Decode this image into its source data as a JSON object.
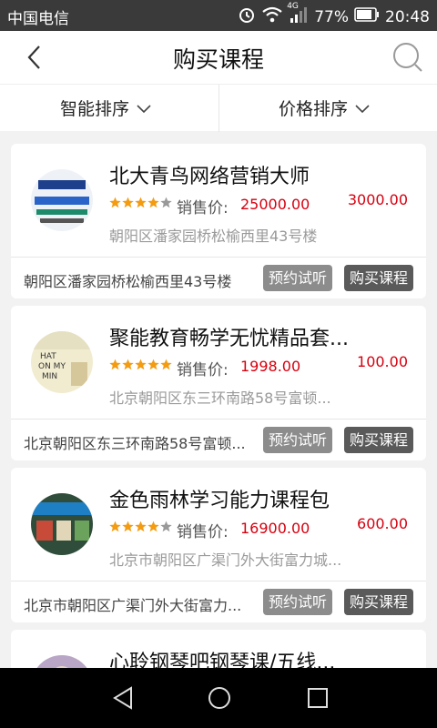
{
  "status": {
    "carrier": "中国电信",
    "network": "4G",
    "battery": "77%",
    "time": "20:48"
  },
  "header": {
    "title": "购买课程"
  },
  "sort": {
    "smart": "智能排序",
    "price": "价格排序"
  },
  "labels": {
    "sale_label": "销售价:",
    "trial": "预约试听",
    "buy": "购买课程"
  },
  "courses": [
    {
      "name": "北大青鸟网络营销大师",
      "rating": 4,
      "sale_price": "25000.00",
      "orig_price": "3000.00",
      "address": "朝阳区潘家园桥松榆西里43号楼",
      "address_full": "朝阳区潘家园桥松榆西里43号楼"
    },
    {
      "name": "聚能教育畅学无忧精品套...",
      "rating": 5,
      "sale_price": "1998.00",
      "orig_price": "100.00",
      "address": "北京朝阳区东三环南路58号富顿...",
      "address_full": "北京朝阳区东三环南路58号富顿..."
    },
    {
      "name": "金色雨林学习能力课程包",
      "rating": 4,
      "sale_price": "16900.00",
      "orig_price": "600.00",
      "address": "北京市朝阳区广渠门外大街富力城...",
      "address_full": "北京市朝阳区广渠门外大街富力..."
    },
    {
      "name": "心聆钢琴吧钢琴课/五线..."
    }
  ],
  "colors": {
    "price": "#d7000f",
    "status_bg": "#3a3a3a",
    "trial_btn": "#8c8c8c",
    "buy_btn": "#5a5a5a",
    "star": "#f39c12"
  }
}
